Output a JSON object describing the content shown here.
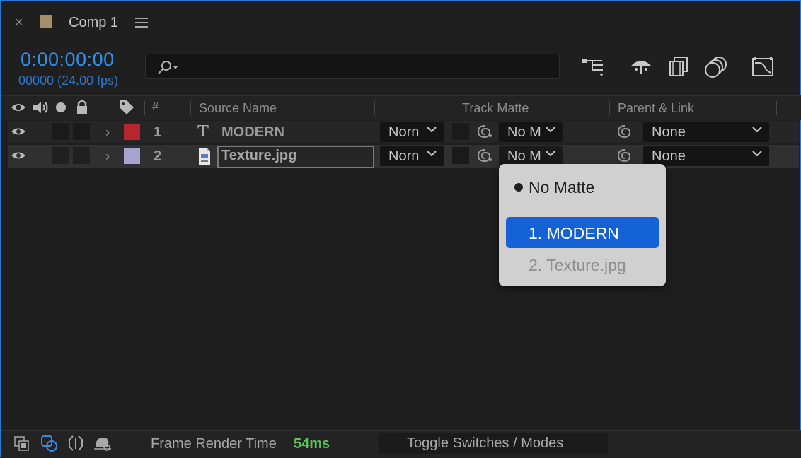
{
  "tab": {
    "close": "×",
    "title": "Comp 1",
    "swatch_color": "#a3906b"
  },
  "timecode": {
    "time": "0:00:00:00",
    "frames": "00000 (24.00 fps)"
  },
  "search": {
    "placeholder": ""
  },
  "toolbar": {
    "icons": [
      "flowchart-icon",
      "shy-icon",
      "frame-blending-icon",
      "motion-blur-icon",
      "graph-editor-icon"
    ]
  },
  "header": {
    "hash": "#",
    "source_name": "Source Name",
    "track_matte": "Track Matte",
    "parent_link": "Parent & Link"
  },
  "layers": [
    {
      "number": "1",
      "name": "MODERN",
      "type": "text",
      "label_color": "#b8262d",
      "mode": "Norn",
      "matte": "No M",
      "parent": "None"
    },
    {
      "number": "2",
      "name": "Texture.jpg",
      "type": "footage",
      "label_color": "#a8a3d0",
      "mode": "Norn",
      "matte": "No M",
      "parent": "None"
    }
  ],
  "popup": {
    "items": [
      {
        "label": "No Matte",
        "checked": true
      },
      {
        "label": "1. MODERN",
        "selected": true
      },
      {
        "label": "2. Texture.jpg",
        "disabled": true
      }
    ]
  },
  "bottom": {
    "render_label": "Frame Render Time",
    "render_value": "54ms",
    "toggle_label": "Toggle Switches / Modes"
  }
}
